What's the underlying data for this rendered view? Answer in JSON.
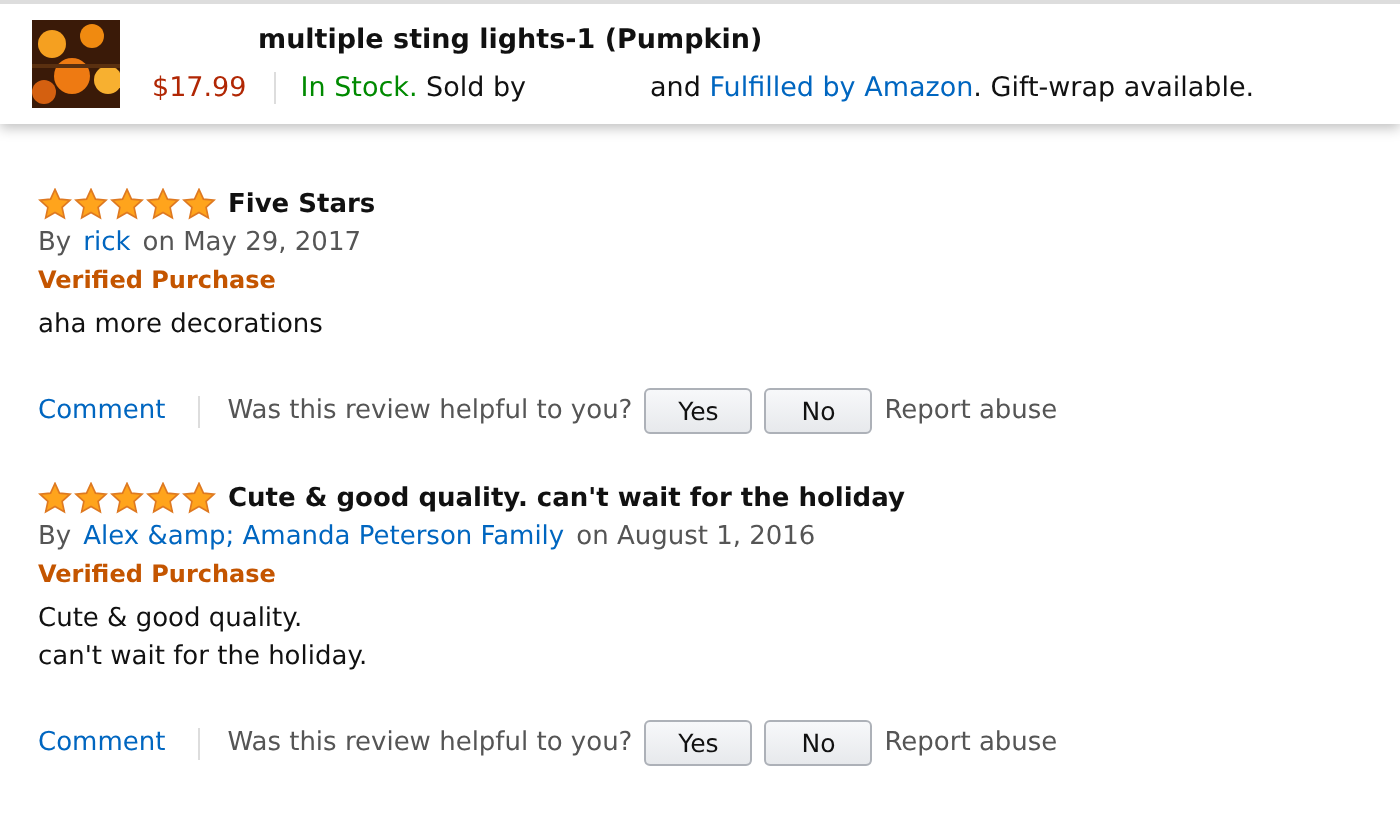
{
  "product_bar": {
    "title": "multiple sting lights-1 (Pumpkin)",
    "price": "$17.99",
    "stock": "In Stock.",
    "sold_by": "Sold by",
    "and_text": "and",
    "fulfilled_link": "Fulfilled by Amazon",
    "gift_text": ". Gift-wrap available."
  },
  "reviews": [
    {
      "stars": 5,
      "title": "Five Stars",
      "by": "By",
      "author": "rick",
      "date": "on May 29, 2017",
      "badge": "Verified Purchase",
      "body": [
        "aha more decorations"
      ],
      "comment": "Comment",
      "question": "Was this review helpful to you?",
      "yes": "Yes",
      "no": "No",
      "report": "Report abuse"
    },
    {
      "stars": 5,
      "title": "Cute & good quality. can't wait for the holiday",
      "by": "By",
      "author": "Alex &amp; Amanda Peterson Family",
      "date": "on August 1, 2016",
      "badge": "Verified Purchase",
      "body": [
        "Cute & good quality.",
        "can't wait for the holiday."
      ],
      "comment": "Comment",
      "question": "Was this review helpful to you?",
      "yes": "Yes",
      "no": "No",
      "report": "Report abuse"
    }
  ]
}
